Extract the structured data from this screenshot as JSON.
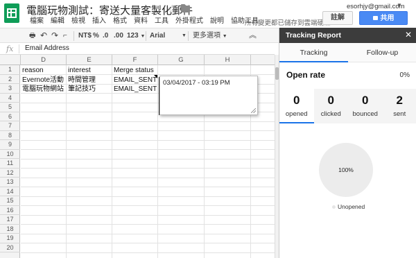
{
  "header": {
    "title": "電腦玩物測試：寄送大量客製化郵件",
    "menu": [
      "檔案",
      "編輯",
      "檢視",
      "插入",
      "格式",
      "資料",
      "工具",
      "外掛程式",
      "說明",
      "協助工具"
    ],
    "save_status": "所有變更都已儲存到雲端硬碟",
    "user_email": "esorhjy@gmail.com",
    "comment_label": "註解",
    "share_label": "共用"
  },
  "toolbar": {
    "currency": "NT$",
    "percent": "%",
    "dec_decrease": ".0",
    "dec_increase": ".00",
    "number_format": "123",
    "font": "Arial",
    "more": "更多選項"
  },
  "formula_bar": {
    "fx": "fx",
    "value": "Email Address"
  },
  "grid": {
    "columns": [
      "D",
      "E",
      "F",
      "G",
      "H"
    ],
    "rows": [
      "1",
      "2",
      "3",
      "4",
      "5",
      "6",
      "7",
      "8",
      "9",
      "10",
      "11",
      "12",
      "13",
      "14",
      "15",
      "16",
      "17",
      "18",
      "19",
      "20"
    ],
    "cells": [
      [
        "reason",
        "interest",
        "Merge status"
      ],
      [
        "Evernote活動",
        "時間管理",
        "EMAIL_SENT"
      ],
      [
        "電腦玩物網站",
        "筆記技巧",
        "EMAIL_SENT"
      ]
    ],
    "note": "03/04/2017 - 03:19 PM"
  },
  "sidebar": {
    "title": "Tracking Report",
    "tabs": [
      "Tracking",
      "Follow-up"
    ],
    "open_rate_label": "Open rate",
    "open_rate_value": "0%",
    "stats": [
      {
        "value": "0",
        "label": "opened"
      },
      {
        "value": "0",
        "label": "clicked"
      },
      {
        "value": "0",
        "label": "bounced"
      },
      {
        "value": "2",
        "label": "sent"
      }
    ],
    "pie_label": "100%",
    "legend": "Unopened"
  },
  "chart_data": {
    "type": "pie",
    "categories": [
      "Unopened"
    ],
    "values": [
      100
    ],
    "title": "",
    "legend_placement": "bottom"
  }
}
